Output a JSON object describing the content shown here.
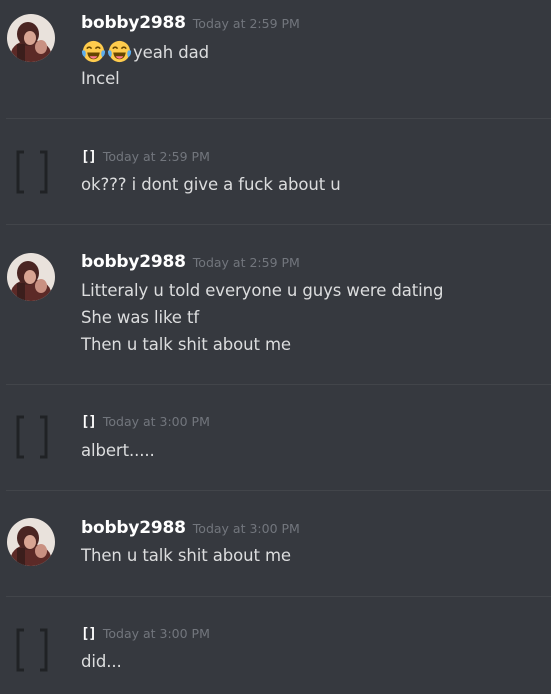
{
  "messages": [
    {
      "author": "bobby2988",
      "timestamp": "Today at 2:59 PM",
      "emoji": [
        "face-with-tears-of-joy",
        "face-with-tears-of-joy"
      ],
      "lines": [
        "yeah dad",
        "Incel"
      ]
    },
    {
      "author": "[]",
      "timestamp": "Today at 2:59 PM",
      "lines": [
        "ok??? i dont give a fuck about u"
      ]
    },
    {
      "author": "bobby2988",
      "timestamp": "Today at 2:59 PM",
      "lines": [
        "Litteraly u told everyone u guys were dating",
        "She was like tf",
        "Then u talk shit about me"
      ]
    },
    {
      "author": "[]",
      "timestamp": "Today at 3:00 PM",
      "lines": [
        "albert....."
      ]
    },
    {
      "author": "bobby2988",
      "timestamp": "Today at 3:00 PM",
      "lines": [
        "Then u talk shit about me"
      ]
    },
    {
      "author": "[]",
      "timestamp": "Today at 3:00 PM",
      "lines": [
        "did..."
      ]
    }
  ],
  "colors": {
    "background": "#36393f",
    "username": "#ffffff",
    "timestamp": "#72767d",
    "message_text": "#dcddde",
    "divider": "#42454a"
  }
}
